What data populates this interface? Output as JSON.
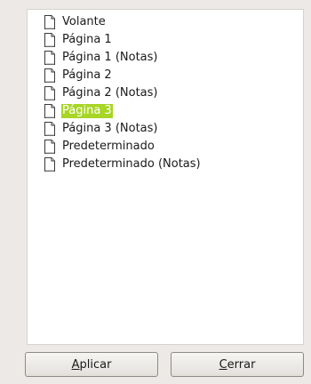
{
  "slides": {
    "items": [
      {
        "label": "Volante",
        "selected": false
      },
      {
        "label": "Página 1",
        "selected": false
      },
      {
        "label": "Página 1 (Notas)",
        "selected": false
      },
      {
        "label": "Página 2",
        "selected": false
      },
      {
        "label": "Página 2 (Notas)",
        "selected": false
      },
      {
        "label": "Página 3",
        "selected": true
      },
      {
        "label": "Página 3 (Notas)",
        "selected": false
      },
      {
        "label": "Predeterminado",
        "selected": false
      },
      {
        "label": "Predeterminado (Notas)",
        "selected": false
      }
    ],
    "icon": "page-icon",
    "selection_color": "#a8d526"
  },
  "buttons": {
    "apply": {
      "mnemonic": "A",
      "rest": "plicar"
    },
    "close": {
      "mnemonic": "C",
      "rest": "errar"
    }
  }
}
